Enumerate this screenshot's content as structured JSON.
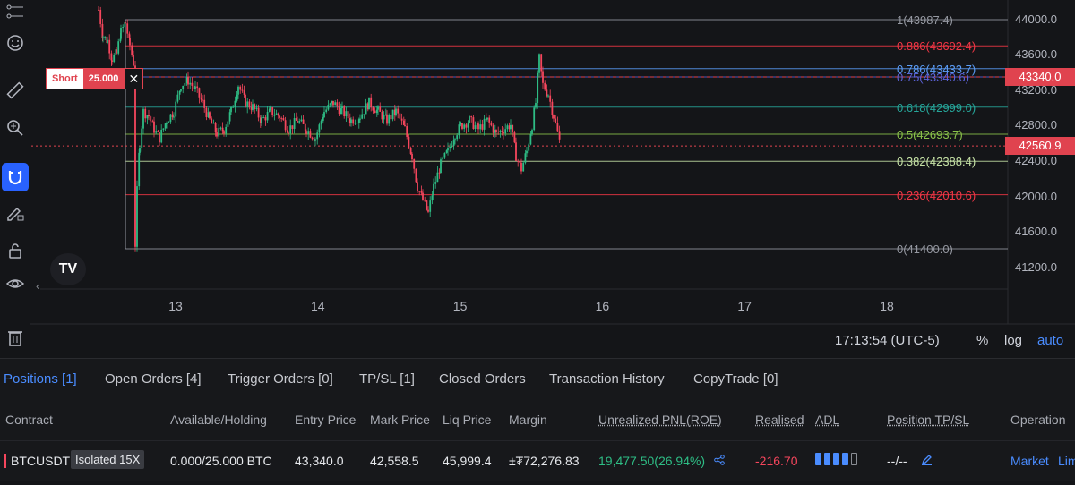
{
  "colors": {
    "accent": "#2962ff",
    "up": "#2ebd85",
    "down": "#f6465d",
    "price_tag": "#e0434f"
  },
  "toolbar": {
    "icons": [
      "trend-tools-icon",
      "emoji-icon",
      "ruler-icon",
      "zoom-icon",
      "magnet-icon",
      "lock-draw-icon",
      "lock-icon",
      "eye-icon",
      "trash-icon"
    ]
  },
  "chart": {
    "fib_levels": [
      {
        "label": "1(43987.4)",
        "price": 43987.4,
        "color": "#9598a1"
      },
      {
        "label": "0.886(43692.4)",
        "price": 43692.4,
        "color": "#f23645"
      },
      {
        "label": "0.786(43433.7)",
        "price": 43433.7,
        "color": "#5b9cf6"
      },
      {
        "label": "0.75(43340.6)",
        "price": 43340.6,
        "color": "#5b62d8"
      },
      {
        "label": "0.618(42999.0)",
        "price": 42999.0,
        "color": "#26a69a"
      },
      {
        "label": "0.5(42693.7)",
        "price": 42693.7,
        "color": "#8bc34a"
      },
      {
        "label": "0.382(42388.4)",
        "price": 42388.4,
        "color": "#c5e1a5"
      },
      {
        "label": "0.236(42010.6)",
        "price": 42010.6,
        "color": "#f23645"
      },
      {
        "label": "0(41400.0)",
        "price": 41400.0,
        "color": "#9598a1"
      }
    ],
    "price_ticks": [
      "44000.0",
      "43600.0",
      "43200.0",
      "42800.0",
      "42400.0",
      "42000.0",
      "41600.0",
      "41200.0"
    ],
    "price_tags": [
      {
        "label": "43340.0",
        "price": 43340.0
      },
      {
        "label": "42560.9",
        "price": 42560.9
      }
    ],
    "date_ticks": [
      "13",
      "14",
      "15",
      "16",
      "17",
      "18"
    ],
    "order": {
      "side": "Short",
      "qty": "25.000",
      "close": "✕"
    },
    "logo": "TV"
  },
  "status": {
    "time": "17:13:54 (UTC-5)",
    "percent": "%",
    "log": "log",
    "auto": "auto"
  },
  "tabs": [
    "Positions [1]",
    "Open Orders [4]",
    "Trigger Orders [0]",
    "TP/SL [1]",
    "Closed Orders",
    "Transaction History",
    "CopyTrade [0]"
  ],
  "columns": [
    "Contract",
    "Available/Holding",
    "Entry Price",
    "Mark Price",
    "Liq Price",
    "Margin",
    "Unrealized PNL(ROE)",
    "Realised",
    "ADL",
    "Position TP/SL",
    "Operation"
  ],
  "position": {
    "contract": "BTCUSDT",
    "mode": "Isolated 15X",
    "available": "0.000/25.000 BTC",
    "entry": "43,340.0",
    "mark": "42,558.5",
    "liq": "45,999.4",
    "margin": "±₮72,276.83",
    "pnl": "19,477.50(26.94%)",
    "realised": "-216.70",
    "adl_level": 4,
    "tpsl": "--/--",
    "op_market": "Market",
    "op_limit": "Lim"
  }
}
